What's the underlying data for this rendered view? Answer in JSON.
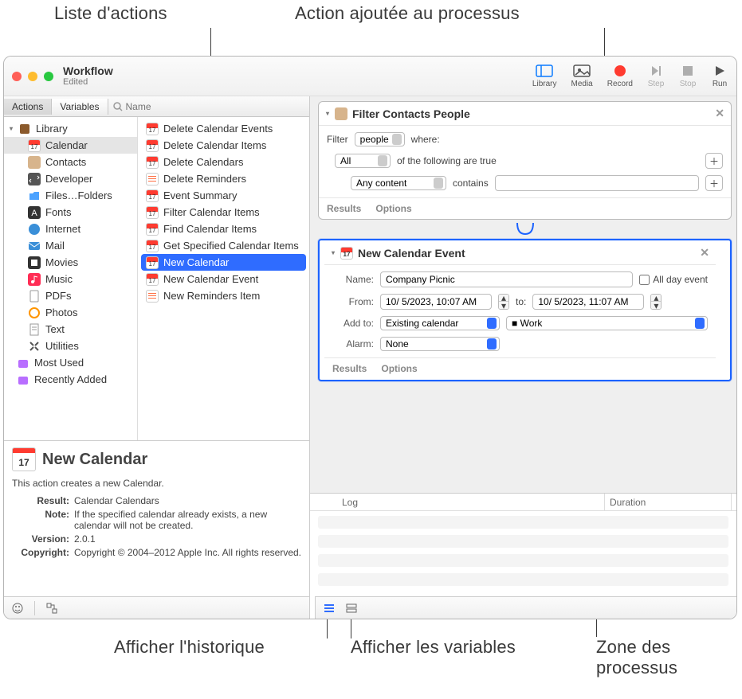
{
  "annotations": {
    "action_list": "Liste d'actions",
    "action_added": "Action ajoutée au processus",
    "show_history": "Afficher l'historique",
    "show_variables": "Afficher les variables",
    "workflow_zone_1": "Zone des",
    "workflow_zone_2": "processus"
  },
  "window": {
    "title": "Workflow",
    "subtitle": "Edited"
  },
  "toolbar": {
    "library": "Library",
    "media": "Media",
    "record": "Record",
    "step": "Step",
    "stop": "Stop",
    "run": "Run"
  },
  "tabs": {
    "actions": "Actions",
    "variables": "Variables"
  },
  "search": {
    "placeholder": "Name"
  },
  "library": {
    "root": "Library",
    "items": [
      "Calendar",
      "Contacts",
      "Developer",
      "Files…Folders",
      "Fonts",
      "Internet",
      "Mail",
      "Movies",
      "Music",
      "PDFs",
      "Photos",
      "Text",
      "Utilities"
    ],
    "most_used": "Most Used",
    "recently_added": "Recently Added"
  },
  "actions": [
    "Delete Calendar Events",
    "Delete Calendar Items",
    "Delete Calendars",
    "Delete Reminders",
    "Event Summary",
    "Filter Calendar Items",
    "Find Calendar Items",
    "Get Specified Calendar Items",
    "New Calendar",
    "New Calendar Event",
    "New Reminders Item"
  ],
  "selected_action_index": 8,
  "info": {
    "title": "New Calendar",
    "desc": "This action creates a new Calendar.",
    "result_k": "Result:",
    "result_v": "Calendar Calendars",
    "note_k": "Note:",
    "note_v": "If the specified calendar already exists, a new calendar will not be created.",
    "version_k": "Version:",
    "version_v": "2.0.1",
    "copyright_k": "Copyright:",
    "copyright_v": "Copyright © 2004–2012 Apple Inc.  All rights reserved."
  },
  "card1": {
    "title": "Filter Contacts People",
    "filter": "Filter",
    "people": "people",
    "where": "where:",
    "all": "All",
    "following": "of the following are true",
    "anycontent": "Any content",
    "contains": "contains",
    "results": "Results",
    "options": "Options"
  },
  "card2": {
    "title": "New Calendar Event",
    "name": "Name:",
    "name_val": "Company Picnic",
    "allday": "All day event",
    "from": "From:",
    "from_val": "10/ 5/2023, 10:07 AM",
    "to": "to:",
    "to_val": "10/ 5/2023, 11:07 AM",
    "addto": "Add to:",
    "addto_val": "Existing calendar",
    "work": "Work",
    "alarm": "Alarm:",
    "alarm_val": "None",
    "results": "Results",
    "options": "Options"
  },
  "log": {
    "log": "Log",
    "duration": "Duration"
  },
  "chart_data": null
}
